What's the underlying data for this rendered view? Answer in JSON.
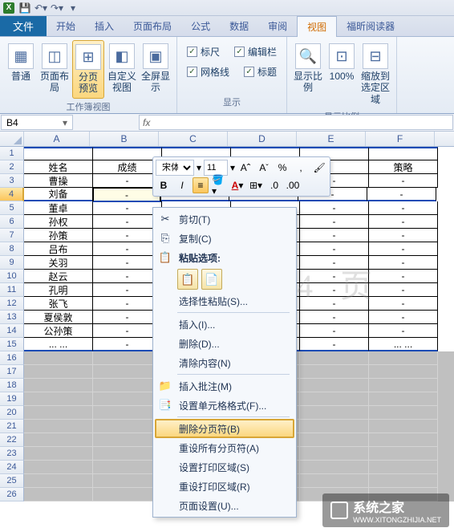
{
  "titlebar": {
    "app_letter": "X"
  },
  "tabs": {
    "file": "文件",
    "items": [
      "开始",
      "插入",
      "页面布局",
      "公式",
      "数据",
      "审阅",
      "视图",
      "福昕阅读器"
    ],
    "active_index": 6
  },
  "ribbon": {
    "views_group": {
      "label": "工作簿视图",
      "normal": "普通",
      "layout": "页面布局",
      "pagebreak_l1": "分页",
      "pagebreak_l2": "预览",
      "custom": "自定义视图",
      "fullscreen": "全屏显示"
    },
    "show_group": {
      "label": "显示",
      "ruler": "标尺",
      "gridlines": "网格线",
      "formulabar": "编辑栏",
      "headings": "标题"
    },
    "zoom_group": {
      "label": "显示比例",
      "zoom": "显示比例",
      "hundred": "100%",
      "fit_l1": "缩放到",
      "fit_l2": "选定区域"
    }
  },
  "namebox": {
    "value": "B4"
  },
  "formula": {
    "fx": "fx",
    "value": ""
  },
  "columns": [
    "A",
    "B",
    "C",
    "D",
    "E",
    "F"
  ],
  "selected_row": 4,
  "sheet_rows": [
    {
      "r": 1,
      "a": "",
      "b": "",
      "c": "",
      "d": "",
      "e": "",
      "f": ""
    },
    {
      "r": 2,
      "a": "姓名",
      "b": "成绩",
      "c": "",
      "d": "",
      "e": "",
      "f": "策略"
    },
    {
      "r": 3,
      "a": "曹操",
      "b": "-",
      "c": "-",
      "d": "-",
      "e": "-",
      "f": "-"
    },
    {
      "r": 4,
      "a": "刘备",
      "b": "-",
      "c": "-",
      "d": "-",
      "e": "-",
      "f": "-"
    },
    {
      "r": 5,
      "a": "董卓",
      "b": "-",
      "c": "-",
      "d": "-",
      "e": "-",
      "f": "-"
    },
    {
      "r": 6,
      "a": "孙权",
      "b": "-",
      "c": "-",
      "d": "-",
      "e": "-",
      "f": "-"
    },
    {
      "r": 7,
      "a": "孙策",
      "b": "-",
      "c": "-",
      "d": "-",
      "e": "-",
      "f": "-"
    },
    {
      "r": 8,
      "a": "吕布",
      "b": "-",
      "c": "-",
      "d": "-",
      "e": "-",
      "f": "-"
    },
    {
      "r": 9,
      "a": "关羽",
      "b": "-",
      "c": "-",
      "d": "-",
      "e": "-",
      "f": "-"
    },
    {
      "r": 10,
      "a": "赵云",
      "b": "-",
      "c": "-",
      "d": "-",
      "e": "-",
      "f": "-"
    },
    {
      "r": 11,
      "a": "孔明",
      "b": "-",
      "c": "-",
      "d": "-",
      "e": "-",
      "f": "-"
    },
    {
      "r": 12,
      "a": "张飞",
      "b": "-",
      "c": "-",
      "d": "-",
      "e": "-",
      "f": "-"
    },
    {
      "r": 13,
      "a": "夏侯敦",
      "b": "-",
      "c": "-",
      "d": "-",
      "e": "-",
      "f": "-"
    },
    {
      "r": 14,
      "a": "公孙策",
      "b": "-",
      "c": "-",
      "d": "-",
      "e": "-",
      "f": "-"
    },
    {
      "r": 15,
      "a": "... ...",
      "b": "-",
      "c": "-",
      "d": "-",
      "e": "-",
      "f": "... ..."
    }
  ],
  "empty_rows": [
    16,
    17,
    18,
    19,
    20,
    21,
    22,
    23,
    24,
    25,
    26
  ],
  "watermark": "4 页",
  "mini": {
    "font": "宋体",
    "size": "11",
    "bold": "B",
    "italic": "I",
    "A_large": "A",
    "A_small": "A",
    "percent": "%",
    "comma": ",",
    "align": "≡",
    "font_color_letter": "A"
  },
  "ctx": {
    "cut": "剪切(T)",
    "copy": "复制(C)",
    "paste_options": "粘贴选项:",
    "paste_special": "选择性粘贴(S)...",
    "insert": "插入(I)...",
    "delete": "删除(D)...",
    "clear": "清除内容(N)",
    "insert_comment": "插入批注(M)",
    "format_cells": "设置单元格格式(F)...",
    "remove_page_break": "删除分页符(B)",
    "reset_all_breaks": "重设所有分页符(A)",
    "set_print_area": "设置打印区域(S)",
    "reset_print_area": "重设打印区域(R)",
    "page_setup": "页面设置(U)..."
  },
  "footer_brand": {
    "name": "系统之家",
    "url": "WWW.XITONGZHIJIA.NET"
  }
}
